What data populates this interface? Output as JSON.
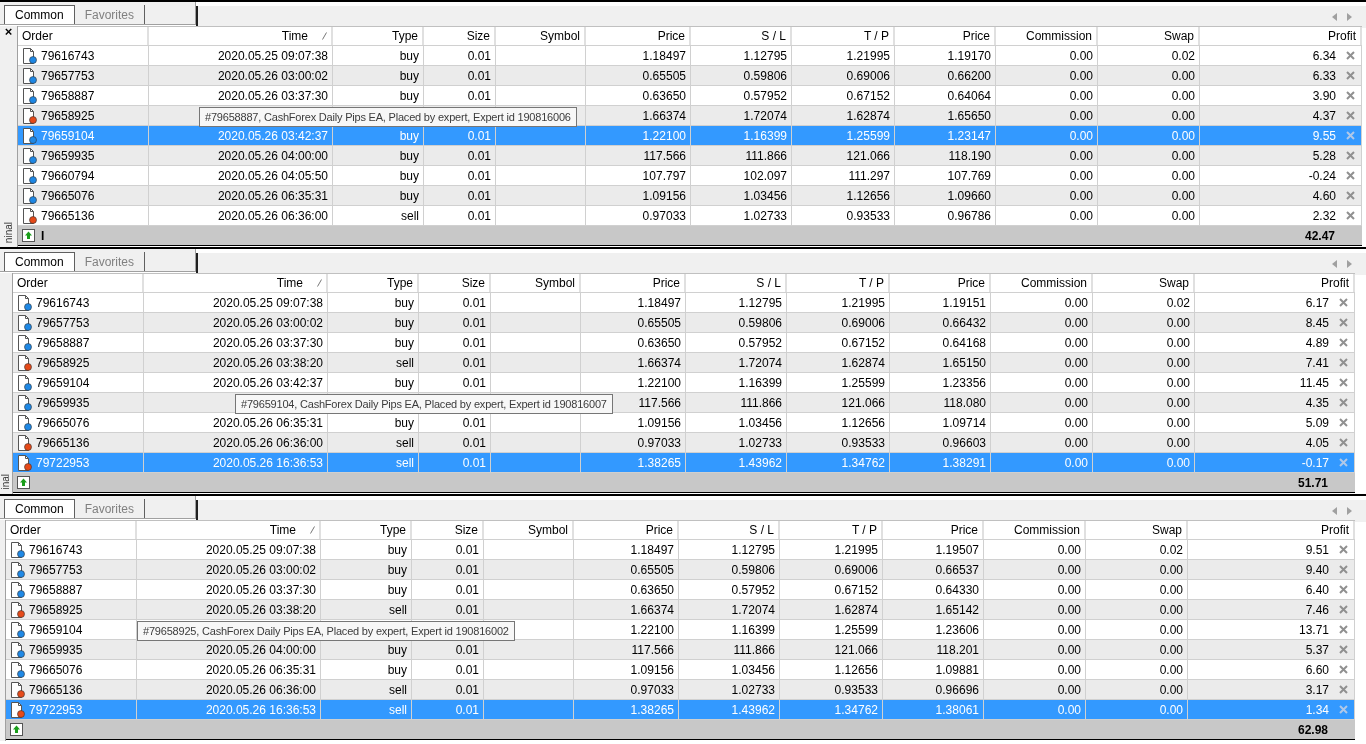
{
  "panels": [
    {
      "side_close": "×",
      "side_label": "ninal",
      "tabs": [
        {
          "label": "Common",
          "selected": true
        },
        {
          "label": "Favorites",
          "selected": false
        }
      ],
      "columns": [
        {
          "label": "Order",
          "sorted": false
        },
        {
          "label": "Time",
          "sorted": true
        },
        {
          "label": "Type",
          "sorted": false
        },
        {
          "label": "Size",
          "sorted": false
        },
        {
          "label": "Symbol",
          "sorted": false
        },
        {
          "label": "Price",
          "sorted": false
        },
        {
          "label": "S / L",
          "sorted": false
        },
        {
          "label": "T / P",
          "sorted": false
        },
        {
          "label": "Price",
          "sorted": false
        },
        {
          "label": "Commission",
          "sorted": false
        },
        {
          "label": "Swap",
          "sorted": false
        },
        {
          "label": "Profit",
          "sorted": false
        }
      ],
      "rows": [
        {
          "kind": "buy",
          "selected": false,
          "order": "79616743",
          "time": "2020.05.25 09:07:38",
          "type": "buy",
          "size": "0.01",
          "price": "1.18497",
          "sl": "1.12795",
          "tp": "1.21995",
          "price_now": "1.19170",
          "commission": "0.00",
          "swap": "0.02",
          "profit": "6.34"
        },
        {
          "kind": "buy",
          "selected": false,
          "order": "79657753",
          "time": "2020.05.26 03:00:02",
          "type": "buy",
          "size": "0.01",
          "price": "0.65505",
          "sl": "0.59806",
          "tp": "0.69006",
          "price_now": "0.66200",
          "commission": "0.00",
          "swap": "0.00",
          "profit": "6.33"
        },
        {
          "kind": "buy",
          "selected": false,
          "order": "79658887",
          "time": "2020.05.26 03:37:30",
          "type": "buy",
          "size": "0.01",
          "price": "0.63650",
          "sl": "0.57952",
          "tp": "0.67152",
          "price_now": "0.64064",
          "commission": "0.00",
          "swap": "0.00",
          "profit": "3.90"
        },
        {
          "kind": "sell",
          "selected": false,
          "order": "79658925",
          "price": "1.66374",
          "sl": "1.72074",
          "tp": "1.62874",
          "price_now": "1.65650",
          "commission": "0.00",
          "swap": "0.00",
          "profit": "4.37",
          "tooltip": "#79658887, CashForex Daily Pips EA, Placed by expert, Expert id 190816006"
        },
        {
          "kind": "buy",
          "selected": true,
          "order": "79659104",
          "time": "2020.05.26 03:42:37",
          "type": "buy",
          "size": "0.01",
          "price": "1.22100",
          "sl": "1.16399",
          "tp": "1.25599",
          "price_now": "1.23147",
          "commission": "0.00",
          "swap": "0.00",
          "profit": "9.55"
        },
        {
          "kind": "buy",
          "selected": false,
          "order": "79659935",
          "time": "2020.05.26 04:00:00",
          "type": "buy",
          "size": "0.01",
          "price": "117.566",
          "sl": "111.866",
          "tp": "121.066",
          "price_now": "118.190",
          "commission": "0.00",
          "swap": "0.00",
          "profit": "5.28"
        },
        {
          "kind": "buy",
          "selected": false,
          "order": "79660794",
          "time": "2020.05.26 04:05:50",
          "type": "buy",
          "size": "0.01",
          "price": "107.797",
          "sl": "102.097",
          "tp": "111.297",
          "price_now": "107.769",
          "commission": "0.00",
          "swap": "0.00",
          "profit": "-0.24"
        },
        {
          "kind": "buy",
          "selected": false,
          "order": "79665076",
          "time": "2020.05.26 06:35:31",
          "type": "buy",
          "size": "0.01",
          "price": "1.09156",
          "sl": "1.03456",
          "tp": "1.12656",
          "price_now": "1.09660",
          "commission": "0.00",
          "swap": "0.00",
          "profit": "4.60"
        },
        {
          "kind": "sell",
          "selected": false,
          "order": "79665136",
          "time": "2020.05.26 06:36:00",
          "type": "sell",
          "size": "0.01",
          "price": "0.97033",
          "sl": "1.02733",
          "tp": "0.93533",
          "price_now": "0.96786",
          "commission": "0.00",
          "swap": "0.00",
          "profit": "2.32"
        }
      ],
      "total": {
        "label": "I",
        "profit": "42.47"
      }
    },
    {
      "side_label": "inal",
      "tabs": [
        {
          "label": "Common",
          "selected": true
        },
        {
          "label": "Favorites",
          "selected": false
        }
      ],
      "columns": [
        {
          "label": "Order",
          "sorted": false
        },
        {
          "label": "Time",
          "sorted": true
        },
        {
          "label": "Type",
          "sorted": false
        },
        {
          "label": "Size",
          "sorted": false
        },
        {
          "label": "Symbol",
          "sorted": false
        },
        {
          "label": "Price",
          "sorted": false
        },
        {
          "label": "S / L",
          "sorted": false
        },
        {
          "label": "T / P",
          "sorted": false
        },
        {
          "label": "Price",
          "sorted": false
        },
        {
          "label": "Commission",
          "sorted": false
        },
        {
          "label": "Swap",
          "sorted": false
        },
        {
          "label": "Profit",
          "sorted": false
        }
      ],
      "rows": [
        {
          "kind": "buy",
          "selected": false,
          "order": "79616743",
          "time": "2020.05.25 09:07:38",
          "type": "buy",
          "size": "0.01",
          "price": "1.18497",
          "sl": "1.12795",
          "tp": "1.21995",
          "price_now": "1.19151",
          "commission": "0.00",
          "swap": "0.02",
          "profit": "6.17"
        },
        {
          "kind": "buy",
          "selected": false,
          "order": "79657753",
          "time": "2020.05.26 03:00:02",
          "type": "buy",
          "size": "0.01",
          "price": "0.65505",
          "sl": "0.59806",
          "tp": "0.69006",
          "price_now": "0.66432",
          "commission": "0.00",
          "swap": "0.00",
          "profit": "8.45"
        },
        {
          "kind": "buy",
          "selected": false,
          "order": "79658887",
          "time": "2020.05.26 03:37:30",
          "type": "buy",
          "size": "0.01",
          "price": "0.63650",
          "sl": "0.57952",
          "tp": "0.67152",
          "price_now": "0.64168",
          "commission": "0.00",
          "swap": "0.00",
          "profit": "4.89"
        },
        {
          "kind": "sell",
          "selected": false,
          "order": "79658925",
          "time": "2020.05.26 03:38:20",
          "type": "sell",
          "size": "0.01",
          "price": "1.66374",
          "sl": "1.72074",
          "tp": "1.62874",
          "price_now": "1.65150",
          "commission": "0.00",
          "swap": "0.00",
          "profit": "7.41"
        },
        {
          "kind": "buy",
          "selected": false,
          "order": "79659104",
          "time": "2020.05.26 03:42:37",
          "type": "buy",
          "size": "0.01",
          "price": "1.22100",
          "sl": "1.16399",
          "tp": "1.25599",
          "price_now": "1.23356",
          "commission": "0.00",
          "swap": "0.00",
          "profit": "11.45"
        },
        {
          "kind": "buy",
          "selected": false,
          "order": "79659935",
          "price": "117.566",
          "sl": "111.866",
          "tp": "121.066",
          "price_now": "118.080",
          "commission": "0.00",
          "swap": "0.00",
          "profit": "4.35",
          "tooltip": "#79659104, CashForex Daily Pips EA, Placed by expert, Expert id 190816007"
        },
        {
          "kind": "buy",
          "selected": false,
          "order": "79665076",
          "time": "2020.05.26 06:35:31",
          "type": "buy",
          "size": "0.01",
          "price": "1.09156",
          "sl": "1.03456",
          "tp": "1.12656",
          "price_now": "1.09714",
          "commission": "0.00",
          "swap": "0.00",
          "profit": "5.09"
        },
        {
          "kind": "sell",
          "selected": false,
          "order": "79665136",
          "time": "2020.05.26 06:36:00",
          "type": "sell",
          "size": "0.01",
          "price": "0.97033",
          "sl": "1.02733",
          "tp": "0.93533",
          "price_now": "0.96603",
          "commission": "0.00",
          "swap": "0.00",
          "profit": "4.05"
        },
        {
          "kind": "sell",
          "selected": true,
          "order": "79722953",
          "time": "2020.05.26 16:36:53",
          "type": "sell",
          "size": "0.01",
          "price": "1.38265",
          "sl": "1.43962",
          "tp": "1.34762",
          "price_now": "1.38291",
          "commission": "0.00",
          "swap": "0.00",
          "profit": "-0.17"
        }
      ],
      "total": {
        "profit": "51.71"
      }
    },
    {
      "tabs": [
        {
          "label": "Common",
          "selected": true
        },
        {
          "label": "Favorites",
          "selected": false
        }
      ],
      "columns": [
        {
          "label": "Order",
          "sorted": false
        },
        {
          "label": "Time",
          "sorted": true
        },
        {
          "label": "Type",
          "sorted": false
        },
        {
          "label": "Size",
          "sorted": false
        },
        {
          "label": "Symbol",
          "sorted": false
        },
        {
          "label": "Price",
          "sorted": false
        },
        {
          "label": "S / L",
          "sorted": false
        },
        {
          "label": "T / P",
          "sorted": false
        },
        {
          "label": "Price",
          "sorted": false
        },
        {
          "label": "Commission",
          "sorted": false
        },
        {
          "label": "Swap",
          "sorted": false
        },
        {
          "label": "Profit",
          "sorted": false
        }
      ],
      "rows": [
        {
          "kind": "buy",
          "selected": false,
          "order": "79616743",
          "time": "2020.05.25 09:07:38",
          "type": "buy",
          "size": "0.01",
          "price": "1.18497",
          "sl": "1.12795",
          "tp": "1.21995",
          "price_now": "1.19507",
          "commission": "0.00",
          "swap": "0.02",
          "profit": "9.51"
        },
        {
          "kind": "buy",
          "selected": false,
          "order": "79657753",
          "time": "2020.05.26 03:00:02",
          "type": "buy",
          "size": "0.01",
          "price": "0.65505",
          "sl": "0.59806",
          "tp": "0.69006",
          "price_now": "0.66537",
          "commission": "0.00",
          "swap": "0.00",
          "profit": "9.40"
        },
        {
          "kind": "buy",
          "selected": false,
          "order": "79658887",
          "time": "2020.05.26 03:37:30",
          "type": "buy",
          "size": "0.01",
          "price": "0.63650",
          "sl": "0.57952",
          "tp": "0.67152",
          "price_now": "0.64330",
          "commission": "0.00",
          "swap": "0.00",
          "profit": "6.40"
        },
        {
          "kind": "sell",
          "selected": false,
          "order": "79658925",
          "time": "2020.05.26 03:38:20",
          "type": "sell",
          "size": "0.01",
          "price": "1.66374",
          "sl": "1.72074",
          "tp": "1.62874",
          "price_now": "1.65142",
          "commission": "0.00",
          "swap": "0.00",
          "profit": "7.46"
        },
        {
          "kind": "buy",
          "selected": false,
          "order": "79659104",
          "price": "1.22100",
          "sl": "1.16399",
          "tp": "1.25599",
          "price_now": "1.23606",
          "commission": "0.00",
          "swap": "0.00",
          "profit": "13.71",
          "tooltip": "#79658925, CashForex Daily Pips EA, Placed by expert, Expert id 190816002"
        },
        {
          "kind": "buy",
          "selected": false,
          "order": "79659935",
          "time": "2020.05.26 04:00:00",
          "type": "buy",
          "size": "0.01",
          "price": "117.566",
          "sl": "111.866",
          "tp": "121.066",
          "price_now": "118.201",
          "commission": "0.00",
          "swap": "0.00",
          "profit": "5.37"
        },
        {
          "kind": "buy",
          "selected": false,
          "order": "79665076",
          "time": "2020.05.26 06:35:31",
          "type": "buy",
          "size": "0.01",
          "price": "1.09156",
          "sl": "1.03456",
          "tp": "1.12656",
          "price_now": "1.09881",
          "commission": "0.00",
          "swap": "0.00",
          "profit": "6.60"
        },
        {
          "kind": "sell",
          "selected": false,
          "order": "79665136",
          "time": "2020.05.26 06:36:00",
          "type": "sell",
          "size": "0.01",
          "price": "0.97033",
          "sl": "1.02733",
          "tp": "0.93533",
          "price_now": "0.96696",
          "commission": "0.00",
          "swap": "0.00",
          "profit": "3.17"
        },
        {
          "kind": "sell",
          "selected": true,
          "order": "79722953",
          "time": "2020.05.26 16:36:53",
          "type": "sell",
          "size": "0.01",
          "price": "1.38265",
          "sl": "1.43962",
          "tp": "1.34762",
          "price_now": "1.38061",
          "commission": "0.00",
          "swap": "0.00",
          "profit": "1.34"
        }
      ],
      "total": {
        "profit": "62.98"
      }
    }
  ]
}
